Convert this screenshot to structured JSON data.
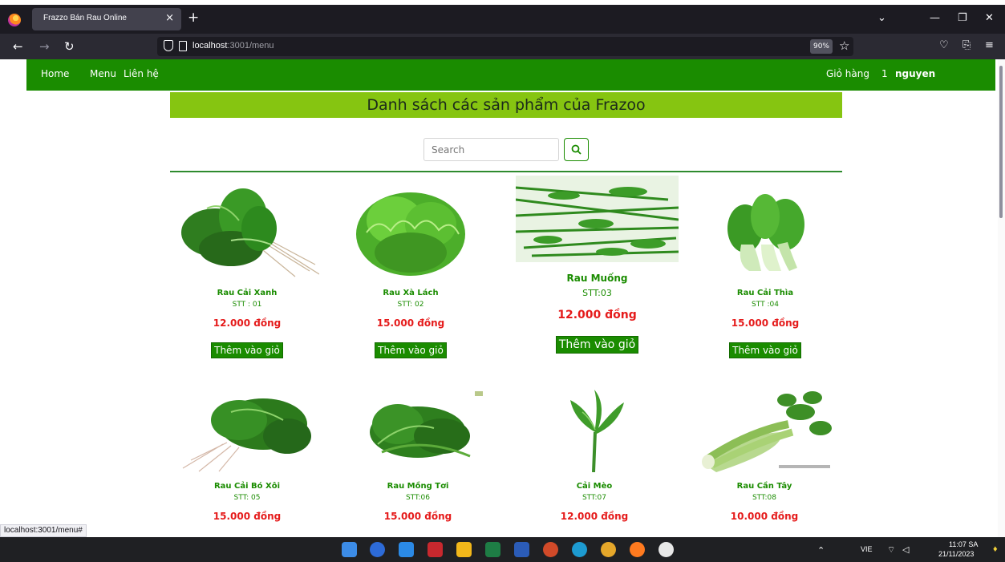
{
  "browser": {
    "tab_title": "Frazzo Bán Rau Online",
    "url_host": "localhost",
    "url_path": ":3001/menu",
    "zoom": "90%"
  },
  "nav": {
    "home": "Home",
    "menu": "Menu",
    "contact": "Liên hệ",
    "cart": "Giỏ hàng",
    "cart_count": "1",
    "user": "nguyen"
  },
  "page": {
    "title": "Danh sách các sản phẩm của Frazoo",
    "search_placeholder": "Search",
    "add_to_cart": "Thêm vào giỏ"
  },
  "products": [
    {
      "name": "Rau Cải Xanh",
      "stt": "STT : 01",
      "price": "12.000 đồng"
    },
    {
      "name": "Rau Xà Lách",
      "stt": "STT: 02",
      "price": "15.000 đồng"
    },
    {
      "name": "Rau Muống",
      "stt": "STT:03",
      "price": "12.000 đồng"
    },
    {
      "name": "Rau Cải Thìa",
      "stt": "STT :04",
      "price": "15.000 đồng"
    },
    {
      "name": "Rau Cải Bó Xôi",
      "stt": "STT: 05",
      "price": "15.000 đồng"
    },
    {
      "name": "Rau Mồng Tơi",
      "stt": "STT:06",
      "price": "15.000 đồng"
    },
    {
      "name": "Cải Mèo",
      "stt": "STT:07",
      "price": "12.000 đồng"
    },
    {
      "name": "Rau Cần Tây",
      "stt": "STT:08",
      "price": "10.000 đồng"
    }
  ],
  "status_tip": "localhost:3001/menu#",
  "tray": {
    "lang": "VIE",
    "time": "11:07 SA",
    "date": "21/11/2023"
  },
  "colors": {
    "nav_green": "#1a8c00",
    "title_band": "#86c511",
    "price_red": "#e51b1b"
  }
}
